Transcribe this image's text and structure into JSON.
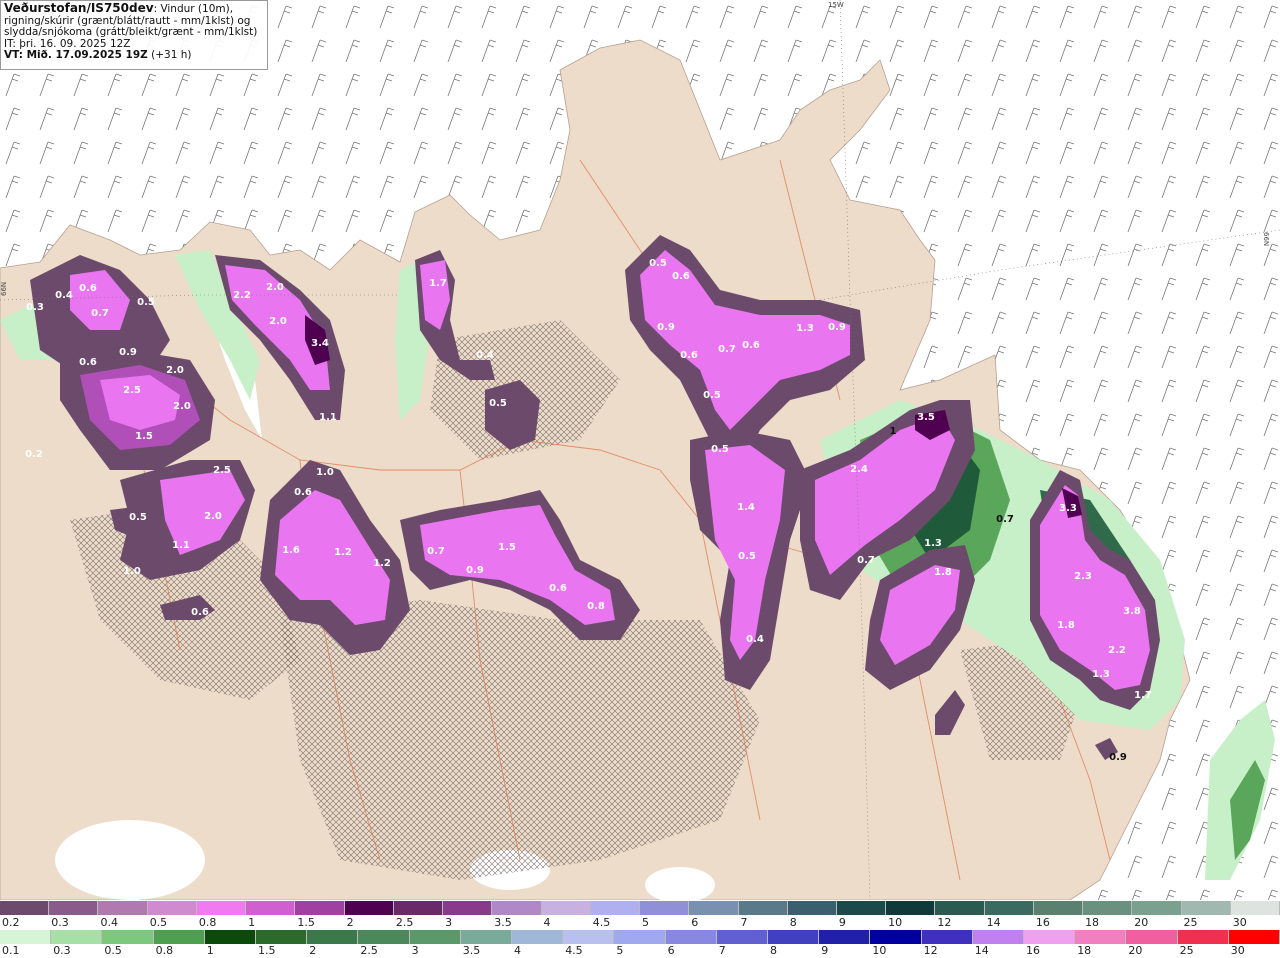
{
  "title": {
    "brand": "Veðurstofan/IS750dev",
    "description_line1": ": Vindur (10m),",
    "description_line2": "rigning/skúrir (grænt/blátt/rautt - mm/1klst) og",
    "description_line3": "slydda/snjókoma (grátt/bleikt/grænt - mm/1klst)",
    "it_line": "IT: þri. 16. 09. 2025 12Z",
    "vt_line": "VT: Mið. 17.09.2025 19Z",
    "vt_offset": " (+31 h)"
  },
  "graticule_labels": {
    "top": "15W",
    "left": "66N",
    "right": "66N"
  },
  "colors": {
    "land": "#ecdcc9",
    "sea": "#ffffff",
    "roads": "#e07a50",
    "snow_light": "#6b4a6b",
    "snow_mid": "#b04fb8",
    "snow_heavy": "#e975f0",
    "rain_light": "#c8f0c8",
    "rain_mid": "#5aa65a",
    "rain_heavy": "#1f5a3a"
  },
  "precip_labels": [
    {
      "text": "0.3"
    },
    {
      "text": "0.4"
    },
    {
      "text": "0.6"
    },
    {
      "text": "0.5"
    },
    {
      "text": "0.7"
    },
    {
      "text": "0.6"
    },
    {
      "text": "0.9"
    },
    {
      "text": "2.5"
    },
    {
      "text": "2.0"
    },
    {
      "text": "2.0"
    },
    {
      "text": "1.5"
    },
    {
      "text": "0.2"
    },
    {
      "text": "2.5"
    },
    {
      "text": "2.0"
    },
    {
      "text": "0.5"
    },
    {
      "text": "1.1"
    },
    {
      "text": "1.0"
    },
    {
      "text": "0.6"
    },
    {
      "text": "2.2"
    },
    {
      "text": "2.0"
    },
    {
      "text": "2.0"
    },
    {
      "text": "3.4"
    },
    {
      "text": "1.1"
    },
    {
      "text": "1.0"
    },
    {
      "text": "0.6"
    },
    {
      "text": "1.6"
    },
    {
      "text": "1.2"
    },
    {
      "text": "1.2"
    },
    {
      "text": "1.7"
    },
    {
      "text": "0.4"
    },
    {
      "text": "0.5"
    },
    {
      "text": "0.7"
    },
    {
      "text": "1.5"
    },
    {
      "text": "0.9"
    },
    {
      "text": "0.6"
    },
    {
      "text": "0.8"
    },
    {
      "text": "0.5"
    },
    {
      "text": "0.6"
    },
    {
      "text": "0.9"
    },
    {
      "text": "0.6"
    },
    {
      "text": "0.7"
    },
    {
      "text": "0.6"
    },
    {
      "text": "1.3"
    },
    {
      "text": "0.9"
    },
    {
      "text": "0.5"
    },
    {
      "text": "0.5"
    },
    {
      "text": "1.4"
    },
    {
      "text": "0.5"
    },
    {
      "text": "0.4"
    },
    {
      "text": "3.5"
    },
    {
      "text": "2.4"
    },
    {
      "text": "1.3"
    },
    {
      "text": "0.7"
    },
    {
      "text": "1.8"
    },
    {
      "text": "0.7"
    },
    {
      "text": "3.3"
    },
    {
      "text": "2.3"
    },
    {
      "text": "1.8"
    },
    {
      "text": "3.8"
    },
    {
      "text": "2.2"
    },
    {
      "text": "1.3"
    },
    {
      "text": "1.7"
    },
    {
      "text": "0.9"
    },
    {
      "text": "1"
    }
  ],
  "legend_snow": {
    "labels": [
      "0.2",
      "0.3",
      "0.4",
      "0.5",
      "0.8",
      "1",
      "1.5",
      "2",
      "2.5",
      "3",
      "3.5",
      "4",
      "4.5",
      "5",
      "6",
      "7",
      "8",
      "9",
      "10",
      "12",
      "14",
      "16",
      "18",
      "20",
      "25",
      "30"
    ],
    "colors": [
      "#6b4a6b",
      "#8a5a8a",
      "#b07ab0",
      "#d08ad0",
      "#f07af0",
      "#d060d0",
      "#a040a0",
      "#500050",
      "#6a2a6a",
      "#8a3a8a",
      "#b088c8",
      "#c8b0e0",
      "#b0b0f0",
      "#9090d8",
      "#7a90b0",
      "#5a7a8a",
      "#3a6070",
      "#1a4a4a",
      "#103a3a",
      "#2a5a50",
      "#3a6a60",
      "#5a8070",
      "#6a9080",
      "#7aa090",
      "#a0b8b0",
      "#dde4e0"
    ]
  },
  "legend_rain": {
    "labels": [
      "0.1",
      "0.3",
      "0.5",
      "0.8",
      "1",
      "1.5",
      "2",
      "2.5",
      "3",
      "3.5",
      "4",
      "4.5",
      "5",
      "6",
      "7",
      "8",
      "9",
      "10",
      "12",
      "14",
      "16",
      "18",
      "20",
      "25",
      "30"
    ],
    "colors": [
      "#d6f5d6",
      "#a6e0a6",
      "#7cc87c",
      "#4ea04e",
      "#0a4a0a",
      "#2a6a2a",
      "#3a7a4a",
      "#4a8a5a",
      "#5a9a6a",
      "#7aaa9a",
      "#a0b8d8",
      "#b8c0f0",
      "#a0a8f0",
      "#8888e0",
      "#6060d0",
      "#4040c0",
      "#2020a8",
      "#0000a0",
      "#4030c0",
      "#c080f0",
      "#f0a0f0",
      "#f080c0",
      "#f060a0",
      "#f03050",
      "#ff0000"
    ]
  }
}
